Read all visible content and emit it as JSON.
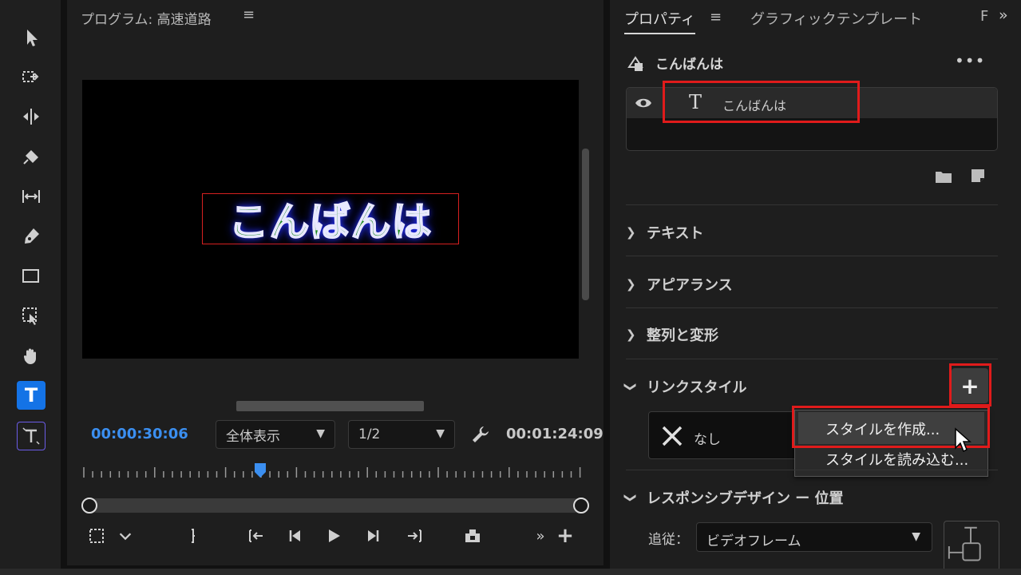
{
  "tools": [
    {
      "name": "selection-tool",
      "icon": "arrow-icon"
    },
    {
      "name": "track-select-forward-tool",
      "icon": "track-select-icon"
    },
    {
      "name": "ripple-edit-tool",
      "icon": "ripple-edit-icon"
    },
    {
      "name": "razor-tool",
      "icon": "razor-icon"
    },
    {
      "name": "slip-tool",
      "icon": "slip-icon"
    },
    {
      "name": "pen-tool",
      "icon": "pen-icon"
    },
    {
      "name": "rectangle-tool",
      "icon": "rectangle-icon"
    },
    {
      "name": "select-area-tool",
      "icon": "select-area-icon"
    },
    {
      "name": "hand-tool",
      "icon": "hand-icon"
    },
    {
      "name": "type-tool",
      "icon": "type-icon",
      "label": "T",
      "active": true
    },
    {
      "name": "vertical-type-tool",
      "icon": "vertical-type-icon",
      "label": "T"
    }
  ],
  "program": {
    "title": "プログラム: 高速道路",
    "menu": "≡",
    "title_text": "こんばんは",
    "timecode": "00:00:30:06",
    "zoom": "全体表示",
    "resolution": "1/2",
    "duration": "00:01:24:09",
    "controls_labels": {
      "overflow": "»",
      "add": "+"
    },
    "colors": {
      "timecode": "#3b8ff0",
      "text_fill": "#1e8a1e",
      "glow": "#2630ff",
      "selection": "#d62020"
    }
  },
  "properties": {
    "tabs": {
      "properties": "プロパティ",
      "menu": "≡",
      "graphic_templates": "グラフィックテンプレート",
      "truncated": "F",
      "overflow": "»"
    },
    "layer_header": "こんばんは",
    "more": "•••",
    "layer_name": "こんばんは",
    "layer_type_glyph": "T",
    "sections": {
      "text": "テキスト",
      "appearance": "アピアランス",
      "align_transform": "整列と変形",
      "linked_style": "リンクスタイル",
      "responsive": "レスポンシブデザイン ー 位置"
    },
    "add_style": "+",
    "style_none": "なし",
    "style_menu": {
      "create": "スタイルを作成...",
      "load": "スタイルを読み込む..."
    },
    "follow_label": "追従：",
    "follow_value": "ビデオフレーム",
    "highlight_color": "#e01b1b"
  }
}
